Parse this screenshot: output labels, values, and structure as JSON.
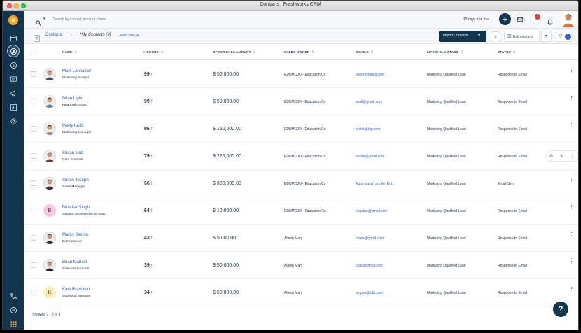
{
  "window": {
    "title": "Contacts : Freshworks CRM"
  },
  "topbar": {
    "search_placeholder": "Search by contact, account, deals",
    "trial_text": "15 days free trial",
    "notification_count": "3"
  },
  "subbar": {
    "breadcrumb_root": "Contacts",
    "view_name": "*My Contacts (9)",
    "save_view": "Save view as",
    "import_label": "Import Contacts",
    "edit_columns": "Edit columns",
    "filter_count": "1"
  },
  "columns": {
    "name": "NAME",
    "score": "SCORE",
    "deals": "OPEN DEALS AMOUNT",
    "owner": "SALES OWNER",
    "emails": "EMAILS",
    "stage": "LIFECYCLE STAGE",
    "status": "STATUS"
  },
  "contacts": [
    {
      "name": "Mark Lancaster",
      "title": "Marketing Analyst",
      "score": "99",
      "deals": "$ 50,000.00",
      "owner": "EDUMOJO - Education Cc",
      "email": "baner@gmail.com",
      "stage": "Marketing Qualified Lead",
      "status": "Response to Email",
      "avatar": "photo",
      "avatar_color": "#3d4a5c"
    },
    {
      "name": "Brian Light",
      "title": "Financial Analyst",
      "score": "99",
      "deals": "$ 50,000.00",
      "owner": "EDUMOJO - Education Cc",
      "email": "avali@gmail.com",
      "stage": "Marketing Qualified Lead",
      "status": "Response to Email",
      "avatar": "photo",
      "avatar_color": "#6b7c8c"
    },
    {
      "name": "Preity Keith",
      "title": "Marketing Manager",
      "score": "96",
      "deals": "$ 150,000.00",
      "owner": "EDUMOJO - Education Cc",
      "email": "pratih@teg.com",
      "stage": "Marketing Qualified Lead",
      "status": "Response to Email",
      "avatar": "photo",
      "avatar_color": "#a98b7c"
    },
    {
      "name": "Susan Matt",
      "title": "Data Scientist",
      "score": "79",
      "deals": "$ 225,000.00",
      "owner": "EDUMOJO - Education Cc",
      "email": "susan@gmail.com",
      "stage": "Marketing Qualified Lead",
      "status": "Response to Email",
      "avatar": "photo",
      "avatar_color": "#5a3d33"
    },
    {
      "name": "Shibin Joseph",
      "title": "Sales Manager",
      "score": "66",
      "deals": "$ 300,000.00",
      "owner": "EDUMOJO - Education Cc",
      "email": "Auto-search profile. Ent...",
      "stage": "Marketing Qualified Lead",
      "status": "Email Sent",
      "avatar": "photo",
      "avatar_color": "#3b2a26"
    },
    {
      "name": "Bhaskar Singh",
      "title": "Student at University of Sout...",
      "score": "64",
      "deals": "$ 10,000.00",
      "owner": "EDUMOJO - Education Cc",
      "email": "bhaskar@gmail.com",
      "stage": "Marketing Qualified Lead",
      "status": "Response to Email",
      "avatar": "B",
      "avatar_color": "#f7c6e0"
    },
    {
      "name": "Martin Sienna",
      "title": "Entrepreneur",
      "score": "43",
      "deals": "$ 5,000.00",
      "owner": "Alleen Mary",
      "email": "cham@gmail.com",
      "stage": "Marketing Qualified Lead",
      "status": "Response to Email",
      "avatar": "photo",
      "avatar_color": "#2f2f35"
    },
    {
      "name": "Brian Mancet",
      "title": "Sciences Explorer",
      "score": "39",
      "deals": "$ 50,000.00",
      "owner": "Alleen Mary",
      "email": "bhati@gmail.com",
      "stage": "Marketing Qualified Lead",
      "status": "Response to Email",
      "avatar": "photo",
      "avatar_color": "#1e1e24"
    },
    {
      "name": "Kate Robinson",
      "title": "Statistical Manager",
      "score": "34",
      "deals": "$ 50,000.00",
      "owner": "Alleen Mary",
      "email": "krupas@xdb.com",
      "stage": "Marketing Qualified Lead",
      "status": "Response to Email",
      "avatar": "K",
      "avatar_color": "#fdf0b8"
    }
  ],
  "footer": {
    "showing": "Showing 1 - 9 of 9"
  },
  "help": {
    "label": "?"
  },
  "colors": {
    "sidebar": "#12344d",
    "link": "#2c5cc5",
    "primary_button": "#12344d",
    "accent": "#f5a623"
  }
}
